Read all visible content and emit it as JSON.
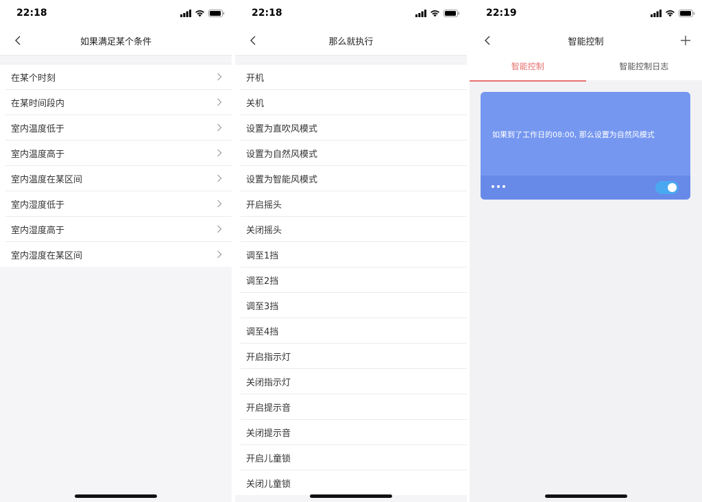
{
  "screen1": {
    "time": "22:18",
    "title": "如果满足某个条件",
    "items": [
      {
        "label": "在某个时刻"
      },
      {
        "label": "在某时间段内"
      },
      {
        "label": "室内温度低于"
      },
      {
        "label": "室内温度高于"
      },
      {
        "label": "室内温度在某区间"
      },
      {
        "label": "室内湿度低于"
      },
      {
        "label": "室内湿度高于"
      },
      {
        "label": "室内湿度在某区间"
      }
    ]
  },
  "screen2": {
    "time": "22:18",
    "title": "那么就执行",
    "items": [
      {
        "label": "开机"
      },
      {
        "label": "关机"
      },
      {
        "label": "设置为直吹风模式"
      },
      {
        "label": "设置为自然风模式"
      },
      {
        "label": "设置为智能风模式"
      },
      {
        "label": "开启摇头"
      },
      {
        "label": "关闭摇头"
      },
      {
        "label": "调至1挡"
      },
      {
        "label": "调至2挡"
      },
      {
        "label": "调至3挡"
      },
      {
        "label": "调至4挡"
      },
      {
        "label": "开启指示灯"
      },
      {
        "label": "关闭指示灯"
      },
      {
        "label": "开启提示音"
      },
      {
        "label": "关闭提示音"
      },
      {
        "label": "开启儿童锁"
      },
      {
        "label": "关闭儿童锁"
      }
    ]
  },
  "screen3": {
    "time": "22:19",
    "title": "智能控制",
    "tabs": [
      {
        "label": "智能控制",
        "active": true
      },
      {
        "label": "智能控制日志",
        "active": false
      }
    ],
    "card": {
      "text": "如果到了工作日的08:00, 那么设置为自然风模式",
      "enabled": true
    }
  },
  "colors": {
    "accent": "#e6706e",
    "card": "#7597f0",
    "card_footer": "#678ae9",
    "toggle_on": "#4aa8f0"
  },
  "icons": {
    "back": "chevron-left-icon",
    "row": "chevron-right-icon",
    "add": "plus-icon",
    "signal": "cellular-signal-icon",
    "wifi": "wifi-icon",
    "battery": "battery-icon",
    "more": "more-dots-icon"
  }
}
